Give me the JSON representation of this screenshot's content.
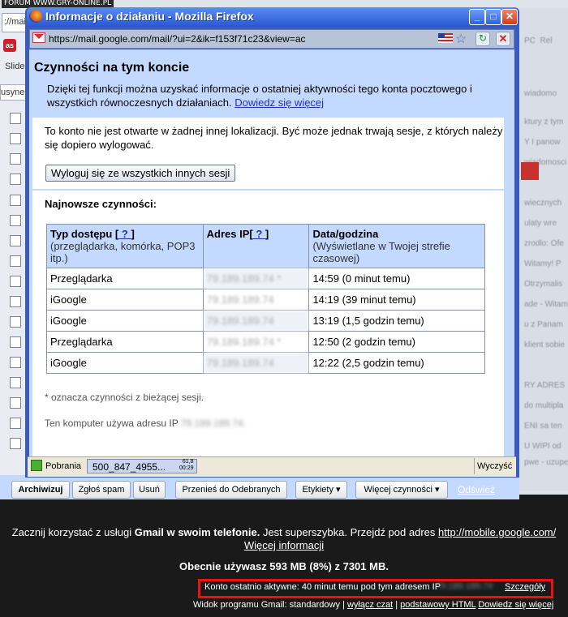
{
  "background": {
    "watermark": "FORUM WWW.GRY-ONLINE.PL",
    "url_fragment": "://mail",
    "lastfm_label": "as",
    "slide_label": "Slide",
    "usyne_label": "usyne",
    "toolbar": {
      "archive": "Archiwizuj",
      "spam": "Zgłoś spam",
      "delete": "Usuń",
      "move_inbox": "Przenieś do Odebranych",
      "labels": "Etykiety ▾",
      "more_actions": "Więcej czynności ▾",
      "refresh": "Odśwież"
    },
    "footer": {
      "mobile_prefix": "Zacznij korzystać z usługi ",
      "mobile_bold": "Gmail w swoim telefonie.",
      "mobile_mid": " Jest superszybka. Przejdź pod adres ",
      "mobile_url": "http://mobile.google.com/",
      "more_info": "Więcej informacji",
      "storage": "Obecnie używasz 593 MB (8%) z 7301 MB.",
      "last_activity": "Konto ostatnio aktywne: 40 minut temu pod tym adresem IP",
      "last_activity_ip": "79.189.189.74",
      "details_link": "Szczegóły",
      "view_prefix": "Widok programu Gmail: standardowy | ",
      "view_chat_off": "wyłącz czat",
      "view_sep": " | ",
      "view_basic_html": "podstawowy HTML",
      "view_learn_more": "Dowiedz się więcej"
    }
  },
  "window": {
    "title": "Informacje o działaniu - Mozilla Firefox",
    "url": "https://mail.google.com/mail/?ui=2&ik=f153f71c23&view=ac",
    "heading": "Czynności na tym koncie",
    "description": "Dzięki tej funkcji można uzyskać informacje o ostatniej aktywności tego konta pocztowego i wszystkich równoczesnych działaniach.",
    "learn_more": "Dowiedz się więcej",
    "info_text": "To konto nie jest otwarte w żadnej innej lokalizacji. Być może jednak trwają sesje, z których należy się dopiero wylogować.",
    "logout_button": "Wyloguj się ze wszystkich innych sesji",
    "recent_title": "Najnowsze czynności:",
    "table": {
      "col1_title": "Typ dostępu [",
      "col1_help": " ? ",
      "col1_close": "]",
      "col1_sub": "(przeglądarka, komórka, POP3 itp.)",
      "col2_title": "Adres IP[",
      "col2_help": " ? ",
      "col2_close": "]",
      "col3_title": "Data/godzina",
      "col3_sub": "(Wyświetlane w Twojej strefie czasowej)",
      "rows": [
        {
          "type": "Przeglądarka",
          "ip": "79.189.189.74 *",
          "time": "14:59 (0 minut temu)"
        },
        {
          "type": "iGoogle",
          "ip": "79.189.189.74",
          "time": "14:19 (39 minut temu)"
        },
        {
          "type": "iGoogle",
          "ip": "79.189.189.74",
          "time": "13:19 (1,5 godzin temu)"
        },
        {
          "type": "Przeglądarka",
          "ip": "79.189.189.74 *",
          "time": "12:50 (2 godzin temu)"
        },
        {
          "type": "iGoogle",
          "ip": "79.189.189.74",
          "time": "12:22 (2,5 godzin temu)"
        }
      ]
    },
    "footnote": "* oznacza czynności z bieżącej sesji.",
    "computer_ip_prefix": "Ten komputer używa adresu IP",
    "computer_ip": "79.189.189.74."
  },
  "statusbar": {
    "downloads": "Pobrania",
    "file": "500_847_4955...",
    "file_size": "61,8",
    "file_time": "00:29",
    "done": "Wyczyść"
  }
}
